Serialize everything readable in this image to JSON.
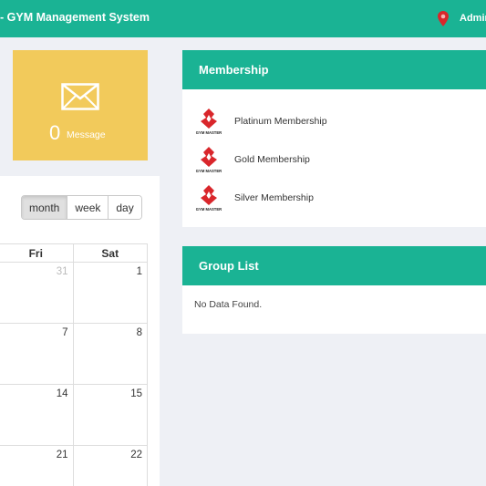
{
  "header": {
    "title": "- GYM Management System",
    "user_name": "Admin"
  },
  "message_card": {
    "count": "0",
    "label": "Message"
  },
  "calendar": {
    "views": [
      "month",
      "week",
      "day"
    ],
    "active_view": "month",
    "day_headers": [
      "Fri",
      "Sat"
    ],
    "weeks": [
      [
        "31",
        "1"
      ],
      [
        "7",
        "8"
      ],
      [
        "14",
        "15"
      ],
      [
        "21",
        "22"
      ]
    ]
  },
  "membership_panel": {
    "title": "Membership",
    "items": [
      {
        "name": "Platinum Membership",
        "logo_text": "GYM MASTER"
      },
      {
        "name": "Gold Membership",
        "logo_text": "GYM MASTER"
      },
      {
        "name": "Silver Membership",
        "logo_text": "GYM MASTER"
      }
    ]
  },
  "group_panel": {
    "title": "Group List",
    "empty_text": "No Data Found."
  },
  "colors": {
    "primary": "#1ab394",
    "message_card": "#f2ca5b",
    "background": "#eef0f5",
    "logo_red": "#d9262b"
  },
  "icons": {
    "user": "map-pin-icon",
    "message": "envelope-icon"
  }
}
